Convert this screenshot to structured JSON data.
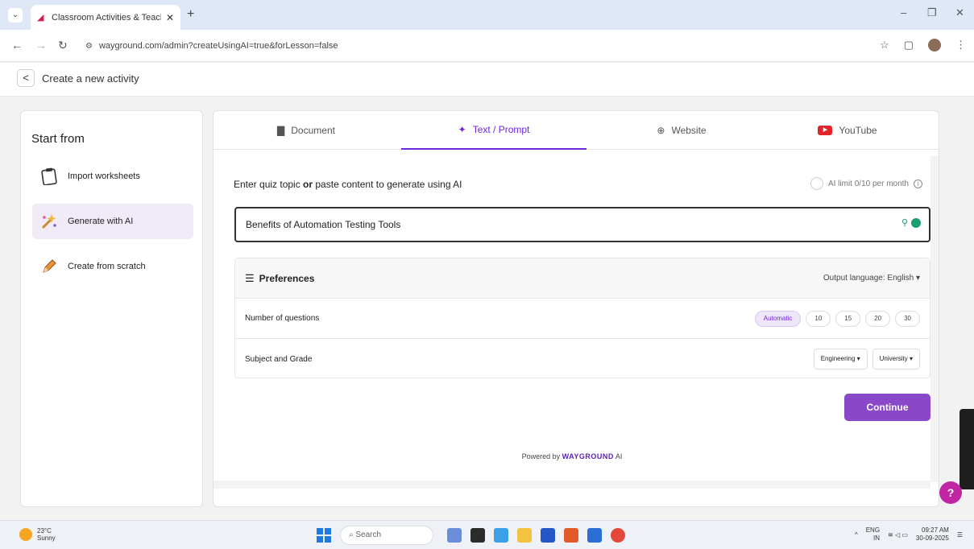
{
  "browser": {
    "tab_title": "Classroom Activities & Teachin",
    "tab_close": "✕",
    "new_tab": "+",
    "url": "wayground.com/admin?createUsingAI=true&forLesson=false"
  },
  "header": {
    "back": "<",
    "title": "Create a new activity"
  },
  "sidebar": {
    "title": "Start from",
    "items": [
      {
        "label": "Import worksheets"
      },
      {
        "label": "Generate with AI"
      },
      {
        "label": "Create from scratch"
      }
    ]
  },
  "tabs": [
    {
      "label": "Document"
    },
    {
      "label": "Text / Prompt"
    },
    {
      "label": "Website"
    },
    {
      "label": "YouTube"
    }
  ],
  "prompt": {
    "label_prefix": "Enter quiz topic ",
    "label_or": "or",
    "label_suffix": " paste content to generate using AI",
    "value": "Benefits of Automation Testing Tools",
    "ai_limit": "AI limit 0/10 per month"
  },
  "preferences": {
    "title": "Preferences",
    "output_language": "Output language: English ▾",
    "num_questions_label": "Number of questions",
    "num_options": [
      "Automatic",
      "10",
      "15",
      "20",
      "30"
    ],
    "subject_grade_label": "Subject and Grade",
    "subject": "Engineering ▾",
    "grade": "University ▾"
  },
  "continue_label": "Continue",
  "powered": {
    "prefix": "Powered by ",
    "brand": "WAYGROUND",
    "suffix": " AI"
  },
  "help_label": "?",
  "taskbar": {
    "temp": "23°C",
    "weather": "Sunny",
    "search": "Search",
    "lang": "ENG",
    "region": "IN",
    "time": "09:27 AM",
    "date": "30-09-2025"
  }
}
